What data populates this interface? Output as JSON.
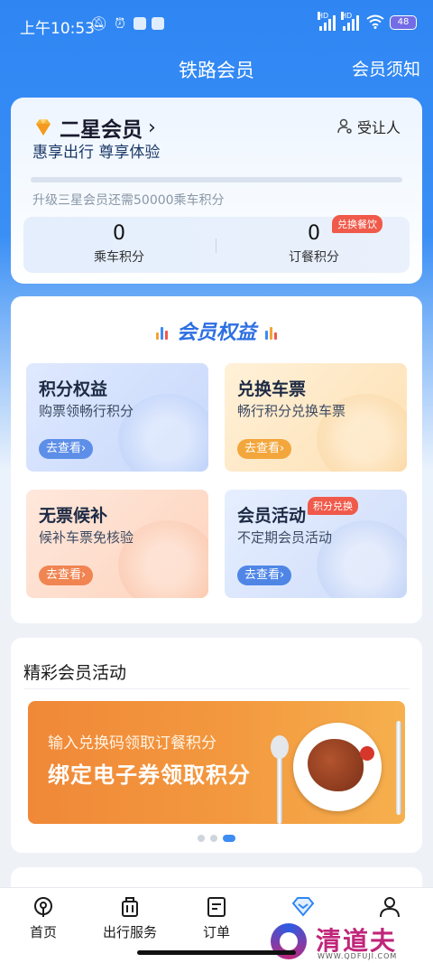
{
  "status_bar": {
    "time": "上午10:53",
    "battery": "48",
    "hd_label": "HD"
  },
  "header": {
    "title": "铁路会员",
    "notice": "会员须知"
  },
  "member": {
    "level": "二星会员",
    "slogan": "惠享出行 尊享体验",
    "yield_label": "受让人",
    "progress": 0,
    "upgrade_hint": "升级三星会员还需50000乘车积分",
    "ride_points": "0",
    "ride_points_label": "乘车积分",
    "meal_points": "0",
    "meal_points_label": "订餐积分",
    "meal_tag": "兑换餐饮"
  },
  "benefits": {
    "title": "会员权益",
    "tiles": [
      {
        "title": "积分权益",
        "subtitle": "购票领畅行积分",
        "button": "去查看›"
      },
      {
        "title": "兑换车票",
        "subtitle": "畅行积分兑换车票",
        "button": "去查看›"
      },
      {
        "title": "无票候补",
        "subtitle": "候补车票免核验",
        "button": "去查看›"
      },
      {
        "title": "会员活动",
        "subtitle": "不定期会员活动",
        "button": "去查看›",
        "tag": "积分兑换"
      }
    ]
  },
  "activities": {
    "title": "精彩会员活动",
    "banner_sub": "输入兑换码领取订餐积分",
    "banner_main": "绑定电子券领取积分",
    "slides": 3,
    "active_slide": 3
  },
  "tabbar": {
    "items": [
      {
        "label": "首页",
        "icon": "home-icon"
      },
      {
        "label": "出行服务",
        "icon": "luggage-icon"
      },
      {
        "label": "订单",
        "icon": "order-icon"
      },
      {
        "label": "",
        "icon": "member-diamond-icon"
      },
      {
        "label": "",
        "icon": "profile-icon"
      }
    ]
  },
  "watermark": {
    "text": "清道夫",
    "sub": "WWW.QDFUJI.COM"
  },
  "colors": {
    "primary": "#2f86f3",
    "accent_red": "#f05a4a",
    "banner_orange": "#f08838"
  }
}
